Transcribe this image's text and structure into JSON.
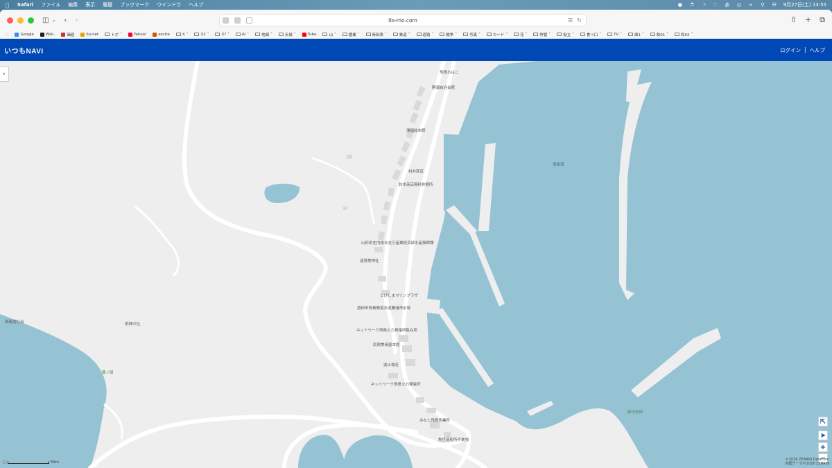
{
  "menubar": {
    "items": [
      "Safari",
      "ファイル",
      "編集",
      "表示",
      "履歴",
      "ブックマーク",
      "ウインドウ",
      "ヘルプ"
    ],
    "input_indicator": "あ",
    "datetime": "9月27日(土) 13:55"
  },
  "browser": {
    "url": "its-mo.com",
    "bookmarks": [
      {
        "label": "Google",
        "type": "site",
        "color": "#4285f4"
      },
      {
        "label": "Wiki.",
        "type": "site",
        "color": "#222222"
      },
      {
        "label": "価値",
        "type": "site",
        "color": "#c0392b"
      },
      {
        "label": "So-net",
        "type": "site",
        "color": "#e6a200"
      },
      {
        "label": "トボ",
        "type": "folder"
      },
      {
        "label": "Yahoo!",
        "type": "site",
        "color": "#ff0033"
      },
      {
        "label": "excite",
        "type": "site",
        "color": "#d35400"
      },
      {
        "label": "X",
        "type": "folder"
      },
      {
        "label": "X2",
        "type": "folder"
      },
      {
        "label": "X?",
        "type": "folder"
      },
      {
        "label": "AI",
        "type": "folder"
      },
      {
        "label": "地図",
        "type": "folder"
      },
      {
        "label": "天候",
        "type": "folder"
      },
      {
        "label": "Tube",
        "type": "site",
        "color": "#ff0000"
      },
      {
        "label": "山",
        "type": "folder"
      },
      {
        "label": "農業",
        "type": "folder"
      },
      {
        "label": "時刻表",
        "type": "folder"
      },
      {
        "label": "鉄道",
        "type": "folder"
      },
      {
        "label": "道路",
        "type": "folder"
      },
      {
        "label": "戦争",
        "type": "folder"
      },
      {
        "label": "写真",
        "type": "folder"
      },
      {
        "label": "カード",
        "type": "folder"
      },
      {
        "label": "花",
        "type": "folder"
      },
      {
        "label": "貯管",
        "type": "folder"
      },
      {
        "label": "役立",
        "type": "folder"
      },
      {
        "label": "食べ口",
        "type": "folder"
      },
      {
        "label": "TV",
        "type": "folder"
      },
      {
        "label": "庫1",
        "type": "folder"
      },
      {
        "label": "和01",
        "type": "folder"
      },
      {
        "label": "和02",
        "type": "folder"
      }
    ]
  },
  "site": {
    "logo": "いつもNAVI",
    "login": "ログイン",
    "separator": "|",
    "help": "ヘルプ"
  },
  "map": {
    "colors": {
      "water": "#96c3d4",
      "land": "#eeeeee",
      "road": "#ffffff",
      "building": "#d9d9d9"
    },
    "labels": [
      {
        "text": "勝浦自治会館",
        "kind": "poi"
      },
      {
        "text": "漁協総本館",
        "kind": "poi"
      },
      {
        "text": "村井商店",
        "kind": "poi"
      },
      {
        "text": "鈴木商店無料休憩所",
        "kind": "poi"
      },
      {
        "text": "山形県庄内総合支庁産業経済部水産振興課",
        "kind": "poi"
      },
      {
        "text": "遠賀美神社",
        "kind": "poi"
      },
      {
        "text": "とびしまマリンプラザ",
        "kind": "poi"
      },
      {
        "text": "酒田市飛島簡易水道勝浦浄水場",
        "kind": "poi"
      },
      {
        "text": "ネットワーク飛島火力発電所駐在所",
        "kind": "poi"
      },
      {
        "text": "民宿美島屋本館",
        "kind": "poi"
      },
      {
        "text": "波止場荘",
        "kind": "poi"
      },
      {
        "text": "ネットワーク飛島火力発電所",
        "kind": "poi"
      },
      {
        "text": "みなと飛島作業所",
        "kind": "poi"
      },
      {
        "text": "魚住造船所作業場",
        "kind": "poi"
      },
      {
        "text": "飛島港",
        "kind": "port"
      },
      {
        "text": "飛島南灯台",
        "kind": "poi"
      },
      {
        "text": "明神の社",
        "kind": "poi"
      },
      {
        "text": "賽ノ磧",
        "kind": "nature"
      },
      {
        "text": "鼓子前崎",
        "kind": "nature"
      },
      {
        "text": "飛島おはこ",
        "kind": "poi"
      }
    ],
    "scale": "50m",
    "copyright_line1": "©2026 ZENRIN DataCom",
    "copyright_line2": "地図データ©2026 ZENRIN"
  }
}
